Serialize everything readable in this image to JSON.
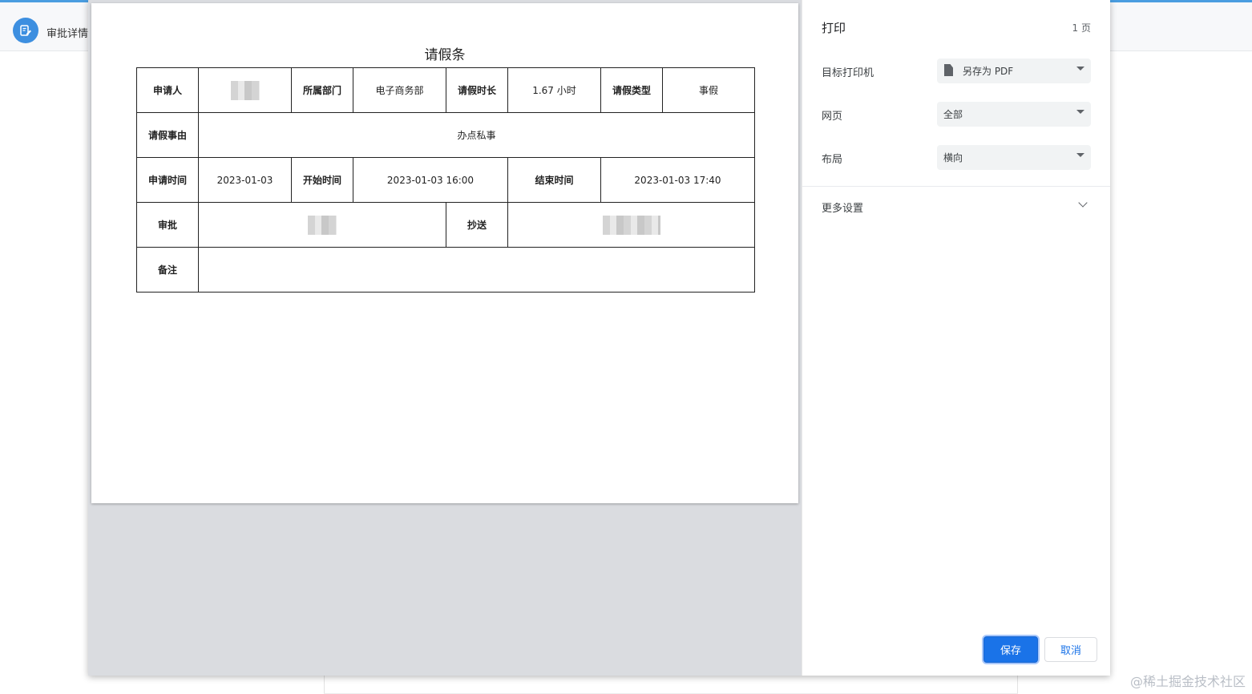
{
  "app": {
    "title": "审批详情",
    "icon": "edit-document-icon",
    "accent_color": "#4a9de0"
  },
  "document": {
    "title": "请假条",
    "labels": {
      "applicant": "申请人",
      "department": "所属部门",
      "duration": "请假时长",
      "leave_type": "请假类型",
      "reason": "请假事由",
      "apply_time": "申请时间",
      "start_time": "开始时间",
      "end_time": "结束时间",
      "approver": "审批",
      "cc": "抄送",
      "remark": "备注"
    },
    "values": {
      "department": "电子商务部",
      "duration": "1.67 小时",
      "leave_type": "事假",
      "reason": "办点私事",
      "apply_time": "2023-01-03",
      "start_time": "2023-01-03 16:00",
      "end_time": "2023-01-03 17:40"
    }
  },
  "print_settings": {
    "title": "打印",
    "page_count": "1 页",
    "destination": {
      "label": "目标打印机",
      "value": "另存为 PDF",
      "icon": "pdf-file-icon"
    },
    "pages": {
      "label": "网页",
      "value": "全部"
    },
    "layout": {
      "label": "布局",
      "value": "横向"
    },
    "more_settings": "更多设置",
    "save_button": "保存",
    "cancel_button": "取消",
    "primary_color": "#1a73e8"
  },
  "watermark": "@稀土掘金技术社区"
}
